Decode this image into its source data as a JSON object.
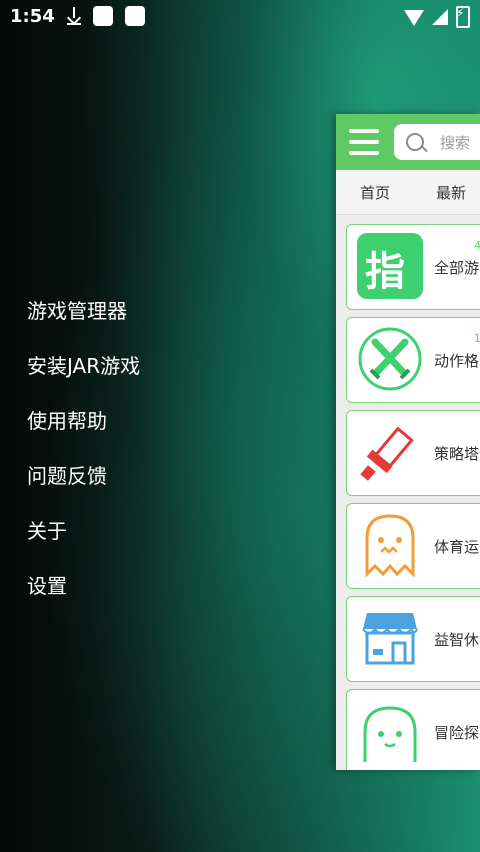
{
  "status_bar": {
    "time": "1:54"
  },
  "drawer": {
    "items": [
      {
        "label": "游戏管理器"
      },
      {
        "label": "安装JAR游戏"
      },
      {
        "label": "使用帮助"
      },
      {
        "label": "问题反馈"
      },
      {
        "label": "关于"
      },
      {
        "label": "设置"
      }
    ]
  },
  "app": {
    "search_placeholder": "搜索",
    "tabs": [
      "首页",
      "最新"
    ],
    "categories": [
      {
        "label": "全部游",
        "count": "4",
        "icon": "zhi-logo-icon"
      },
      {
        "label": "动作格",
        "count": "1",
        "icon": "crossed-swords-icon"
      },
      {
        "label": "策略塔",
        "count": "",
        "icon": "sword-icon"
      },
      {
        "label": "体育运",
        "count": "",
        "icon": "ghost-icon"
      },
      {
        "label": "益智休",
        "count": "",
        "icon": "shop-icon"
      },
      {
        "label": "冒险探",
        "count": "",
        "icon": "blob-face-icon"
      }
    ],
    "colors": {
      "accent": "#5fca65",
      "danger": "#e53935",
      "warning": "#f39c34",
      "info": "#4aa3df"
    }
  }
}
